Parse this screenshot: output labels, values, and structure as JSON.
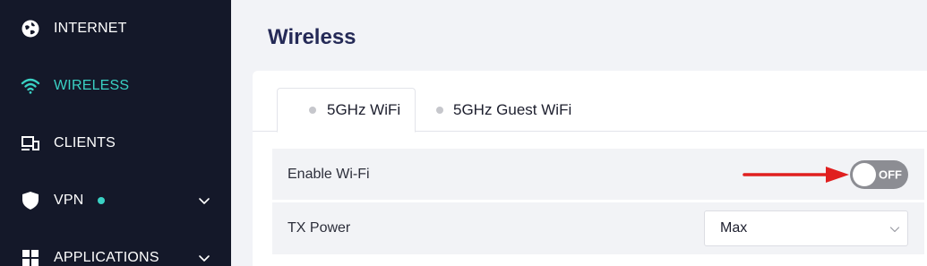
{
  "sidebar": {
    "items": [
      {
        "label": "INTERNET",
        "icon": "globe-icon"
      },
      {
        "label": "WIRELESS",
        "icon": "wifi-icon",
        "active": true
      },
      {
        "label": "CLIENTS",
        "icon": "devices-icon"
      },
      {
        "label": "VPN",
        "icon": "shield-icon",
        "status_dot": true,
        "expandable": true
      },
      {
        "label": "APPLICATIONS",
        "icon": "grid-icon",
        "expandable": true
      }
    ]
  },
  "main": {
    "title": "Wireless",
    "tabs": [
      {
        "label": "5GHz WiFi",
        "active": true
      },
      {
        "label": "5GHz Guest WiFi",
        "active": false
      }
    ],
    "settings": {
      "enable_wifi": {
        "label": "Enable Wi-Fi",
        "state": "OFF"
      },
      "tx_power": {
        "label": "TX Power",
        "value": "Max"
      }
    }
  },
  "colors": {
    "sidebar_bg": "#141829",
    "accent": "#3ad1c4",
    "title": "#252a57",
    "toggle_off": "#8c8d93",
    "annotation_arrow": "#e01f1f"
  }
}
